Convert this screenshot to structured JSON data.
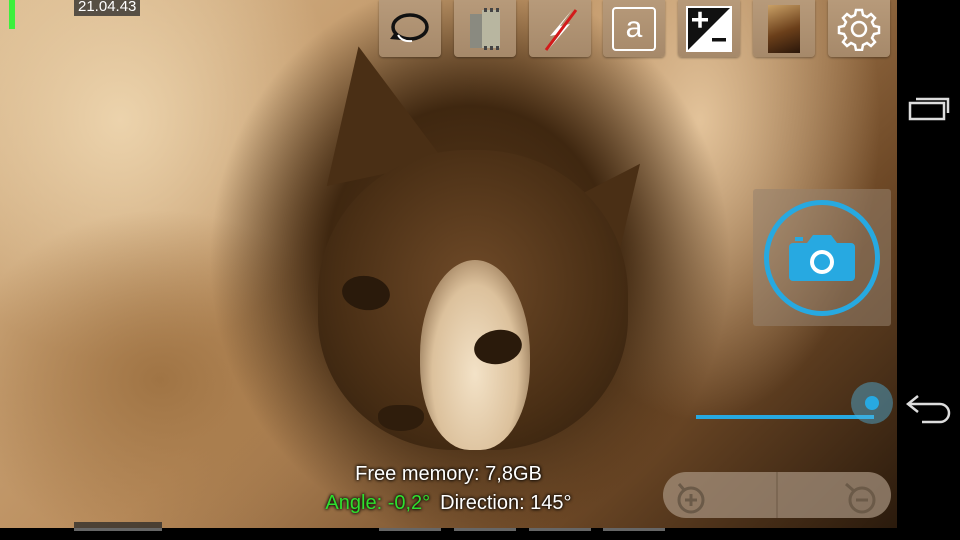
{
  "overlay": {
    "timestamp": "21.04.43",
    "free_memory": "Free memory: 7,8GB",
    "angle": "Angle: -0,2°",
    "direction": "Direction: 145°"
  },
  "toolbar": {
    "buttons": [
      {
        "name": "switch-camera",
        "icon": "rotate-arrow-icon"
      },
      {
        "name": "photo-mode",
        "icon": "film-roll-icon"
      },
      {
        "name": "flash-off",
        "icon": "flash-off-icon"
      },
      {
        "name": "scene-mode",
        "icon": "scene-auto-icon",
        "label": "a"
      },
      {
        "name": "exposure",
        "icon": "exposure-compensation-icon"
      },
      {
        "name": "gallery",
        "icon": "gallery-thumbnail-icon"
      },
      {
        "name": "settings",
        "icon": "gear-icon"
      }
    ]
  },
  "shutter": {
    "icon": "camera-icon",
    "accent": "#27a9e1"
  },
  "zoom": {
    "level": 1.0
  },
  "colors": {
    "accent": "#27a9e1",
    "angle_text": "#2ee02e",
    "level_indicator": "#3cf03c"
  },
  "navigation": {
    "icons": [
      "recent-apps-icon",
      "back-icon"
    ]
  }
}
